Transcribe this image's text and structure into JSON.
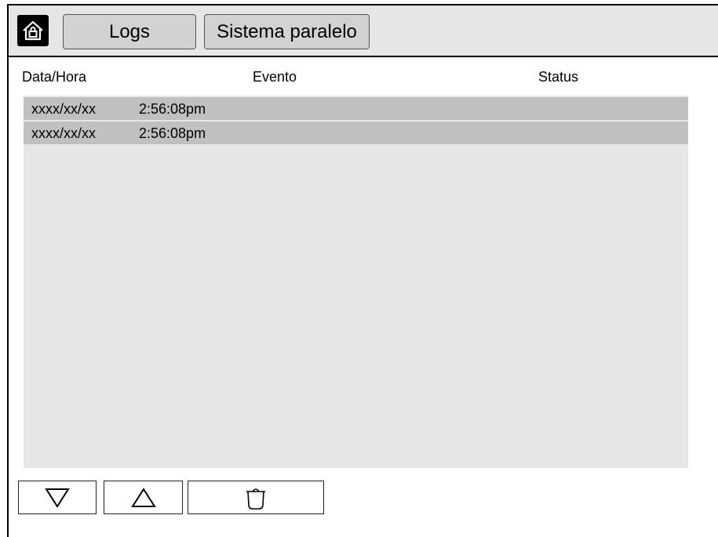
{
  "header": {
    "home_icon": "home-lock-icon",
    "tabs": [
      {
        "label": "Logs"
      },
      {
        "label": "Sistema paralelo"
      }
    ]
  },
  "table": {
    "columns": [
      "Data/Hora",
      "Evento",
      "Status"
    ],
    "rows": [
      {
        "date": "xxxx/xx/xx",
        "time": "2:56:08pm",
        "event": "",
        "status": ""
      },
      {
        "date": "xxxx/xx/xx",
        "time": "2:56:08pm",
        "event": "",
        "status": ""
      }
    ]
  },
  "toolbar": {
    "down_icon": "triangle-down-icon",
    "up_icon": "triangle-up-icon",
    "delete_icon": "trash-icon"
  },
  "colors": {
    "topbar_bg": "#e6e6e6",
    "tab_bg": "#d2d2d2",
    "list_bg": "#e6e6e6",
    "row_bg": "#c0c0c0"
  }
}
